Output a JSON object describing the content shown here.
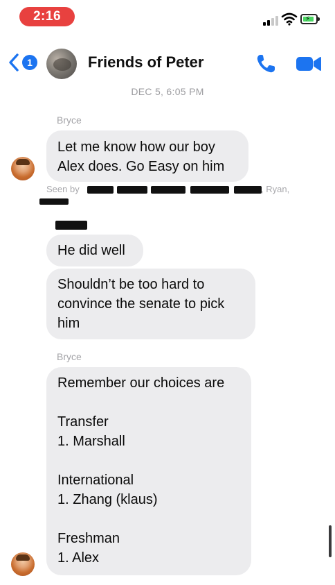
{
  "status_bar": {
    "time": "2:16",
    "signal_icon": "cellular-signal-icon",
    "wifi_icon": "wifi-icon",
    "battery_icon": "battery-charging-icon",
    "battery_level": 0.7,
    "accent_time_color": "#e8413f",
    "battery_color": "#4bd663"
  },
  "header": {
    "back_icon": "chevron-left-icon",
    "unread_count": "1",
    "title": "Friends of Peter",
    "call_icon": "phone-icon",
    "video_icon": "video-camera-icon",
    "accent_color": "#1c74f0"
  },
  "conversation": {
    "timestamp": "DEC 5, 6:05 PM",
    "groups": [
      {
        "sender": "Bryce",
        "messages": [
          {
            "lines": [
              "Let me know how our boy",
              "Alex does. Go Easy on him"
            ]
          }
        ],
        "seen_by_label": "Seen by",
        "seen_by_visible_names": ", Ryan,"
      },
      {
        "sender": "",
        "messages": [
          {
            "lines": [
              "He did well"
            ]
          },
          {
            "lines": [
              "Shouldn’t be too hard to",
              "convince the senate to pick",
              "him"
            ]
          }
        ]
      },
      {
        "sender": "Bryce",
        "messages": [
          {
            "lines": [
              "Remember our choices are",
              "",
              "Transfer",
              "1. Marshall",
              "",
              "International",
              "1. Zhang (klaus)",
              "",
              "Freshman",
              "1. Alex"
            ]
          }
        ]
      }
    ]
  }
}
